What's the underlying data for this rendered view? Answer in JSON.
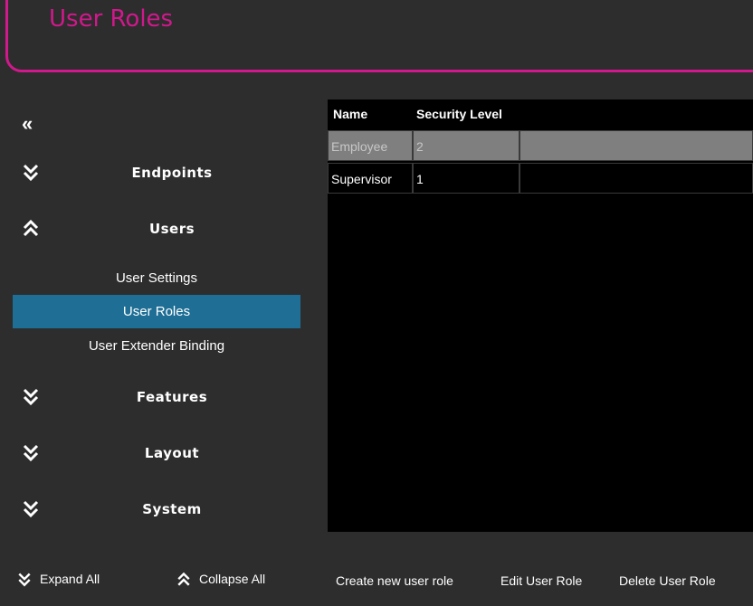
{
  "header": {
    "title": "User Roles"
  },
  "sidebar": {
    "sections": [
      {
        "label": "Endpoints",
        "expanded": false
      },
      {
        "label": "Users",
        "expanded": true
      },
      {
        "label": "Features",
        "expanded": false
      },
      {
        "label": "Layout",
        "expanded": false
      },
      {
        "label": "System",
        "expanded": false
      }
    ],
    "users_subitems": [
      "User Settings",
      "User Roles",
      "User Extender Binding"
    ],
    "active_subitem": "User Roles"
  },
  "table": {
    "columns": [
      "Name",
      "Security Level"
    ],
    "rows": [
      {
        "name": "Employee",
        "level": "2",
        "selected": true
      },
      {
        "name": "Supervisor",
        "level": "1",
        "selected": false
      }
    ]
  },
  "footer": {
    "expand_all": "Expand All",
    "collapse_all": "Collapse All",
    "create": "Create new user role",
    "edit": "Edit User Role",
    "delete": "Delete User Role"
  },
  "colors": {
    "accent": "#d1188c",
    "active": "#1e6e95",
    "background": "#2d2d2d",
    "grid": "#000000",
    "selected_row": "#7f7f7f"
  }
}
